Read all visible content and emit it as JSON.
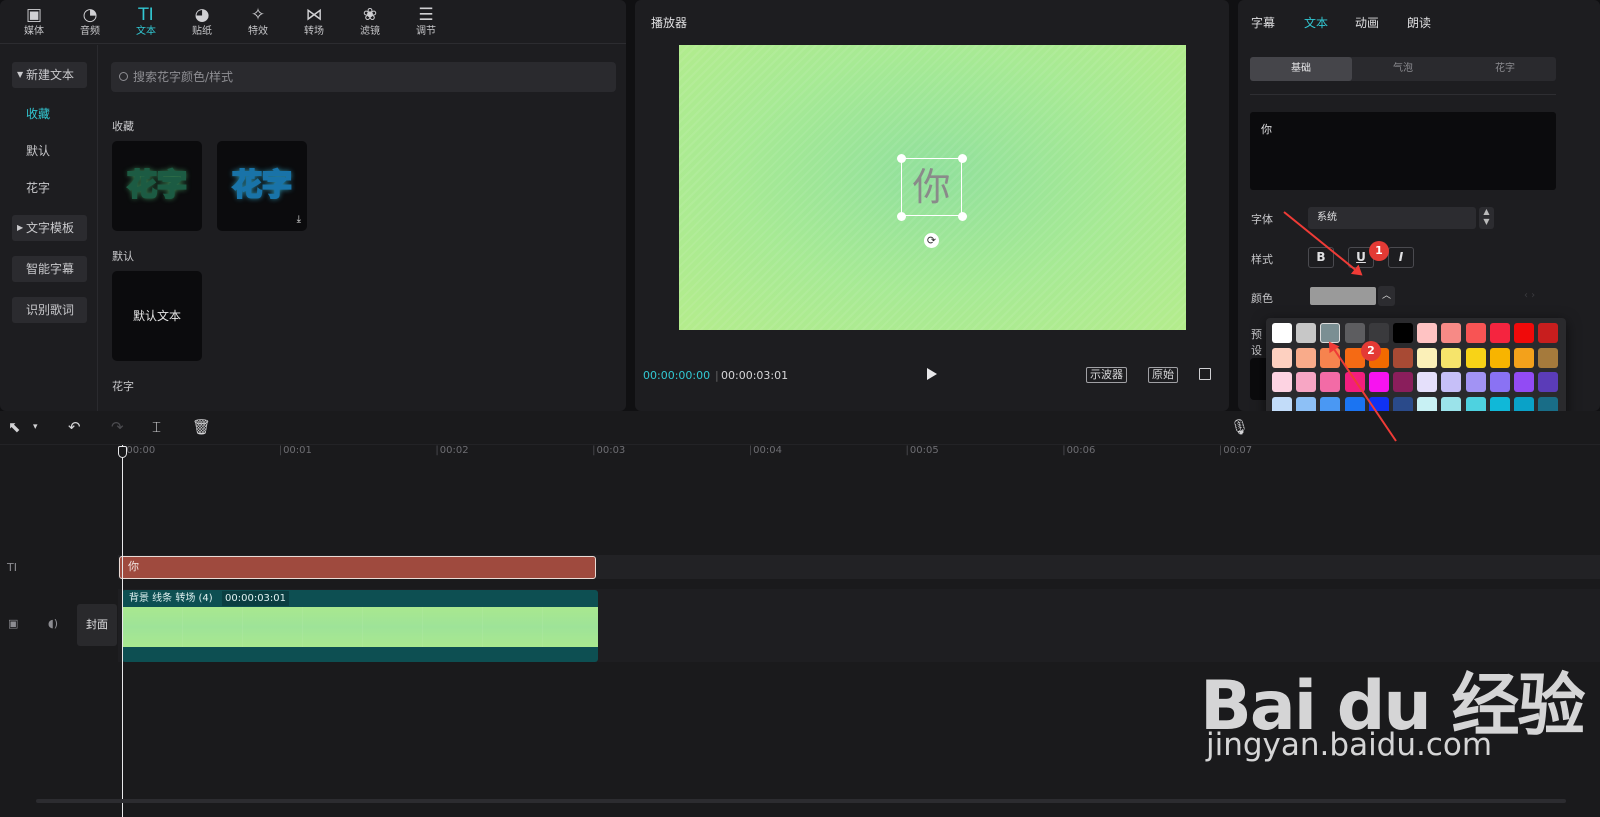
{
  "toolbar": {
    "tools": [
      {
        "label": "媒体",
        "icon": "media-icon",
        "glyph": "▣"
      },
      {
        "label": "音频",
        "icon": "audio-icon",
        "glyph": "◔"
      },
      {
        "label": "文本",
        "icon": "text-icon",
        "glyph": "TI"
      },
      {
        "label": "贴纸",
        "icon": "sticker-icon",
        "glyph": "◕"
      },
      {
        "label": "特效",
        "icon": "effects-icon",
        "glyph": "✧"
      },
      {
        "label": "转场",
        "icon": "transition-icon",
        "glyph": "⋈"
      },
      {
        "label": "滤镜",
        "icon": "filter-icon",
        "glyph": "❀"
      },
      {
        "label": "调节",
        "icon": "adjust-icon",
        "glyph": "☰"
      }
    ],
    "active_index": 2
  },
  "sidebar": {
    "items": [
      {
        "label": "新建文本",
        "expandable": true
      },
      {
        "label": "收藏",
        "selected": true
      },
      {
        "label": "默认"
      },
      {
        "label": "花字"
      },
      {
        "label": "文字模板",
        "expandable": true
      },
      {
        "label": "智能字幕"
      },
      {
        "label": "识别歌词"
      }
    ]
  },
  "library": {
    "search_placeholder": "搜索花字颜色/样式",
    "favorites_title": "收藏",
    "default_title": "默认",
    "huazi_title": "花字",
    "favorites": [
      {
        "text": "花字",
        "style": "green"
      },
      {
        "text": "花字",
        "style": "blue",
        "download": "⤓"
      }
    ],
    "default_item": "默认文本"
  },
  "player": {
    "title": "播放器",
    "overlay_text": "你",
    "current_time": "00:00:00:00",
    "separator": "|",
    "total_time": "00:00:03:01",
    "btn_scope": "示波器",
    "btn_original": "原始"
  },
  "properties": {
    "tabs": [
      "字幕",
      "文本",
      "动画",
      "朗读"
    ],
    "active_tab": 1,
    "subtabs": [
      "基础",
      "气泡",
      "花字"
    ],
    "text_value": "你",
    "font_label": "字体",
    "font_value": "系统",
    "style_label": "样式",
    "style_buttons": [
      "B",
      "U",
      "I"
    ],
    "color_label": "颜色",
    "color_value": "#9a9a9a",
    "preset_label": "预设"
  },
  "color_palette": [
    [
      "#ffffff",
      "#c7c7c7",
      "#7a8f93",
      "#5d5d60",
      "#3a3a3d",
      "#000000",
      "#ffc3c3",
      "#f78a86",
      "#f85454",
      "#f5243f",
      "#f00a0a",
      "#c81e1e"
    ],
    [
      "#fdd0c0",
      "#f9ab8a",
      "#f6834e",
      "#f56a14",
      "#f16a00",
      "#a84a34",
      "#fbf0b8",
      "#f6e46b",
      "#f8d317",
      "#f8b400",
      "#f3a11b",
      "#a57a3c"
    ],
    [
      "#fdd3e2",
      "#f7a6c4",
      "#f36ba6",
      "#f21e7e",
      "#f713f0",
      "#8a1e5c",
      "#e5e0fb",
      "#c6bff8",
      "#a293f4",
      "#8a72f4",
      "#924bf4",
      "#5b3cb8"
    ],
    [
      "#c2dcf9",
      "#8dc0f6",
      "#4a98f3",
      "#1b74f2",
      "#1032f3",
      "#2a4a8a",
      "#c8f1f4",
      "#9be3ea",
      "#4ed2e0",
      "#10b8d8",
      "#0aa2c8",
      "#196d87"
    ],
    [
      "#b9f0c4",
      "#6fe6a5",
      "#1ddb72",
      "#23d449",
      "#1cf14f",
      "#1d8a48",
      "#ebf0c4",
      "#d3dc68",
      "#b5c12f",
      "#7a931f",
      "#5b8a35",
      "#3c6b3a"
    ],
    [
      "#d2c8c2",
      "#b2a49b",
      "#8e7b6e",
      "#7a655a",
      "#6b5a4e",
      "#4a3f36",
      "#f2c6b4",
      "#e2928a",
      "#c86e68",
      "#e9b78a",
      "#d89a78",
      "#b06f50"
    ],
    [
      "#e7d39b",
      "#e9c26a",
      "#c6aa5a",
      "#c6c689",
      "#9aa579",
      "#5c7a68",
      "#5c9a96",
      "#168a88",
      "#2e8a8a",
      "#7cc4d6",
      "#5fb6c0",
      "#3a98b6"
    ],
    [
      "#a4bcd5",
      "#5f86b6",
      "#3b4d6d",
      "#d8bcc9",
      "#b59cb0",
      "#8a5e82"
    ]
  ],
  "timeline": {
    "ruler": [
      "00:00",
      "00:01",
      "00:02",
      "00:03",
      "00:04",
      "00:05",
      "00:06",
      "00:07"
    ],
    "text_track_icon": "TI",
    "text_clip_label": "你",
    "video_clip_label": "背景 线条 转场 (4)",
    "video_clip_duration": "00:00:03:01",
    "cover_label": "封面"
  },
  "annotations": [
    "1",
    "2"
  ],
  "watermark": {
    "logo": "Bai du 经验",
    "url": "jingyan.baidu.com"
  },
  "colors": {
    "accent": "#32c7d2",
    "text_clip": "#9f4a3e",
    "video_clip": "#0d4f52",
    "annotation": "#e43a35"
  }
}
